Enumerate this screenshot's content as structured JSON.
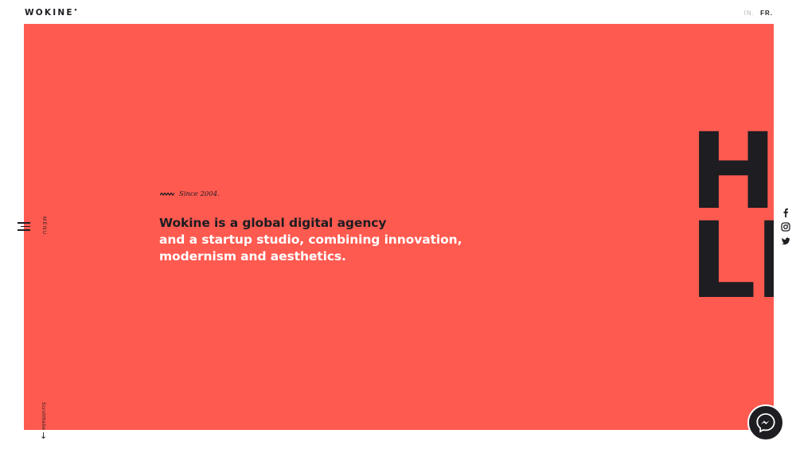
{
  "header": {
    "logo_text": "WOKINE",
    "logo_mark": "•",
    "languages": [
      {
        "label": "IN.",
        "active": false
      },
      {
        "label": "FR.",
        "active": true
      }
    ]
  },
  "hero": {
    "since": "Since 2004.",
    "tagline_line1": "Wokine is a global digital agency",
    "tagline_line2": "and a startup studio, combining innovation,",
    "tagline_line3": "modernism and aesthetics.",
    "big_text_line1": "HE",
    "big_text_line2": "LL",
    "background_color": "#ff5a50"
  },
  "nav": {
    "menu_label": "MENU",
    "scroll_label": "Scrollthebe",
    "scroll_arrow": "↓"
  },
  "social": [
    "facebook-icon",
    "instagram-icon",
    "twitter-icon"
  ],
  "colors": {
    "accent": "#ff5a50",
    "dark": "#1d1d22",
    "white": "#ffffff"
  }
}
